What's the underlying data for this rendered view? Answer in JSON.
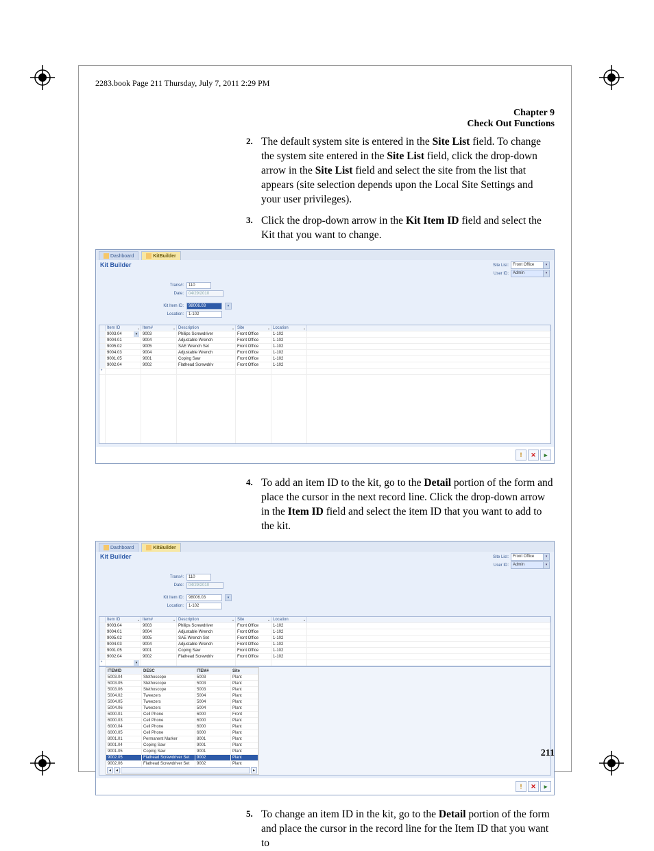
{
  "running_header": "2283.book  Page 211  Thursday, July 7, 2011  2:29 PM",
  "chapter": {
    "num": "Chapter 9",
    "title": "Check Out Functions"
  },
  "steps": {
    "s2": {
      "num": "2.",
      "text_a": "The default system site is entered in the ",
      "b1": "Site List",
      "text_b": " field. To change the system site entered in the ",
      "b2": "Site List",
      "text_c": " field, click the drop-down arrow in the ",
      "b3": "Site List",
      "text_d": " field and select the site from the list that appears (site selection depends upon the Local Site Settings and your user privi­leges)."
    },
    "s3": {
      "num": "3.",
      "text_a": "Click the drop-down arrow in the ",
      "b1": "Kit Item ID",
      "text_b": " field and select the Kit that you want to change."
    },
    "s4": {
      "num": "4.",
      "text_a": "To add an item ID to the kit, go to the ",
      "b1": "Detail",
      "text_b": " portion of the form and place the cursor in the next record line. Click the drop-down arrow in the ",
      "b2": "Item ID",
      "text_c": " field and select the item ID that you want to add to the kit."
    },
    "s5": {
      "num": "5.",
      "text_a": "To change an item ID in the kit, go to the ",
      "b1": "Detail",
      "text_b": " portion of the form and place the cursor in the record line for the Item ID that you want to "
    }
  },
  "ss_common": {
    "tab1": "Dashboard",
    "tab2": "KitBuilder",
    "title": "Kit Builder",
    "site_list_label": "Site List:",
    "site_list_value": "Front Office",
    "user_label": "User ID:",
    "user_value": "Admin",
    "trans_label": "Trans#:",
    "trans_value": "110",
    "date_label": "Date:",
    "date_value": "04/29/2010",
    "kit_label": "Kit Item ID:",
    "kit_value": "98006.03",
    "loc_label": "Location:",
    "loc_value": "1-102",
    "grid_headers": [
      "",
      "Item ID",
      "Item#",
      "Description",
      "Site",
      "Location",
      ""
    ]
  },
  "grid_rows": [
    {
      "item_id": "9003.04",
      "item_no": "9003",
      "desc": "Philips Screwdriver",
      "site": "Front Office",
      "loc": "1-102"
    },
    {
      "item_id": "9004.01",
      "item_no": "9004",
      "desc": "Adjustable Wrench",
      "site": "Front Office",
      "loc": "1-102"
    },
    {
      "item_id": "9005.02",
      "item_no": "9005",
      "desc": "SAE Wrench Set",
      "site": "Front Office",
      "loc": "1-102"
    },
    {
      "item_id": "9004.03",
      "item_no": "9004",
      "desc": "Adjustable Wrench",
      "site": "Front Office",
      "loc": "1-102"
    },
    {
      "item_id": "9001.05",
      "item_no": "9001",
      "desc": "Coping Saw",
      "site": "Front Office",
      "loc": "1-102"
    },
    {
      "item_id": "9002.04",
      "item_no": "9002",
      "desc": "Flathead Screwdriv",
      "site": "Front Office",
      "loc": "1-102"
    }
  ],
  "popup_headers": [
    "ITEMID",
    "DESC",
    "ITEM#",
    "Site"
  ],
  "popup_rows": [
    {
      "id": "5003.04",
      "desc": "Stethoscope",
      "no": "5003",
      "site": "Plant"
    },
    {
      "id": "5003.05",
      "desc": "Stethoscope",
      "no": "5003",
      "site": "Plant"
    },
    {
      "id": "5003.06",
      "desc": "Stethoscope",
      "no": "5003",
      "site": "Plant"
    },
    {
      "id": "5004.02",
      "desc": "Tweezers",
      "no": "5004",
      "site": "Plant"
    },
    {
      "id": "5004.05",
      "desc": "Tweezers",
      "no": "5004",
      "site": "Plant"
    },
    {
      "id": "5004.06",
      "desc": "Tweezers",
      "no": "5004",
      "site": "Plant"
    },
    {
      "id": "6000.01",
      "desc": "Cell Phone",
      "no": "6000",
      "site": "Front"
    },
    {
      "id": "6000.03",
      "desc": "Cell Phone",
      "no": "6000",
      "site": "Plant"
    },
    {
      "id": "6000.04",
      "desc": "Cell Phone",
      "no": "6000",
      "site": "Plant"
    },
    {
      "id": "6000.05",
      "desc": "Cell Phone",
      "no": "6000",
      "site": "Plant"
    },
    {
      "id": "8001.01",
      "desc": "Permanent Marker",
      "no": "8001",
      "site": "Plant"
    },
    {
      "id": "9001.04",
      "desc": "Coping Saw",
      "no": "9001",
      "site": "Plant"
    },
    {
      "id": "9001.05",
      "desc": "Coping Saw",
      "no": "9001",
      "site": "Plant"
    },
    {
      "id": "9002.05",
      "desc": "Flathead Screwdriver Set",
      "no": "9002",
      "site": "Plant",
      "hl": true
    },
    {
      "id": "9002.06",
      "desc": "Flathead Screwdriver Set",
      "no": "9002",
      "site": "Plant"
    }
  ],
  "page_number": "211"
}
